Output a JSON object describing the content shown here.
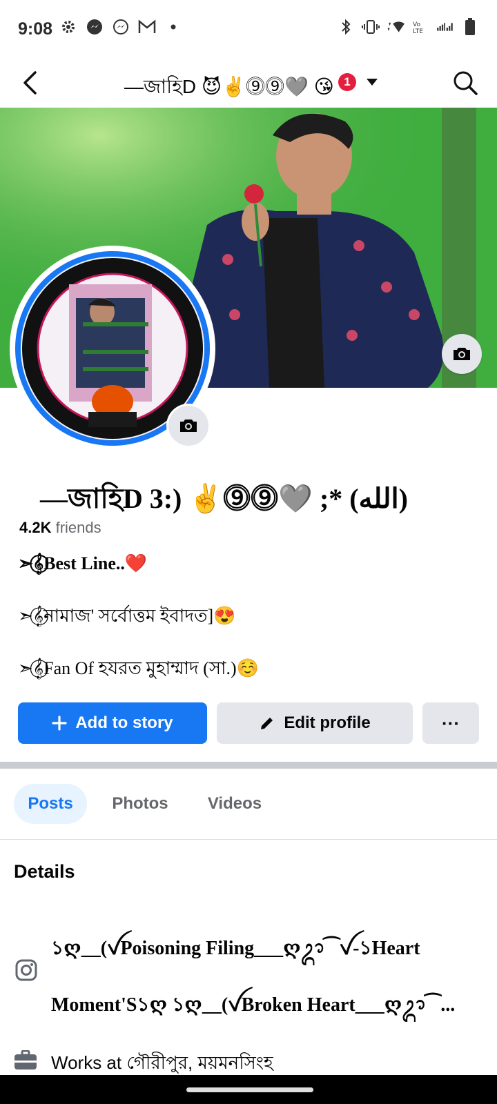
{
  "status_bar": {
    "time": "9:08",
    "left_icons": [
      "settings-icon",
      "messenger-icon",
      "messenger-outline-icon",
      "gmail-icon",
      "dot-icon"
    ],
    "right_icons": [
      "bluetooth-icon",
      "vibrate-icon",
      "wifi-icon",
      "volte-icon",
      "signal-icon",
      "battery-icon"
    ]
  },
  "header": {
    "title": "—জাহিD 😈✌️⓽⓽🩶 😘",
    "notification_count": "1"
  },
  "profile": {
    "name": "—জাহিD 3:) ✌️⓽⓽🩶 ;* (الله)",
    "friends_count": "4.2K",
    "friends_label": "friends",
    "bio_lines": [
      "➣𝄞⃝Best Line..❤️",
      "➣𝄞⃝নামাজ' সর্বোত্তম ইবাদত]😍",
      "➣𝄞⃝Fan Of হযরত  মুহাম্মাদ (সা.)☺️"
    ]
  },
  "actions": {
    "add_story": "Add to story",
    "edit_profile": "Edit profile",
    "more": "···"
  },
  "tabs": [
    "Posts",
    "Photos",
    "Videos"
  ],
  "details": {
    "title": "Details",
    "instagram_text": "১ღ__(ꪜPoisoning Filing___ღᬊ⁀ꪜ-১Heart Moment'S১ღ  ১ღ__(ꪜBroken Heart___ღᬊ⁀...",
    "work_text": "Works at গৌরীপুর, ময়মনসিংহ"
  },
  "colors": {
    "accent": "#1877f2",
    "badge": "#e41e3f",
    "secondary_button": "#e4e6eb"
  }
}
